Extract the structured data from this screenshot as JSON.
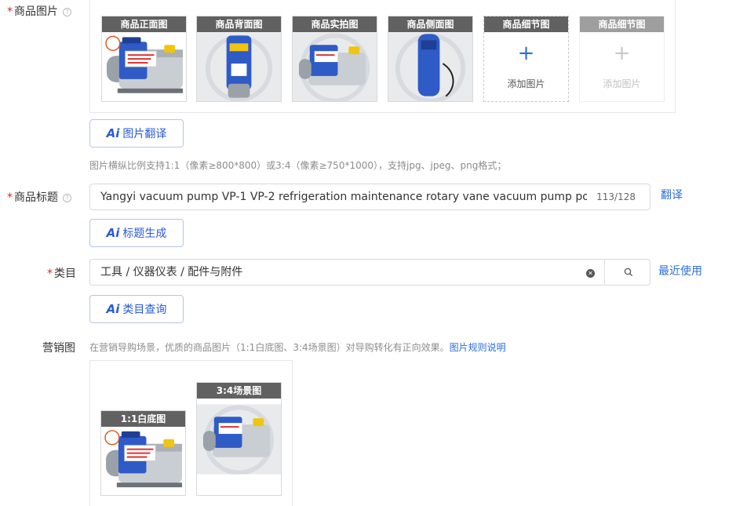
{
  "product_images": {
    "label": "商品图片",
    "slots": [
      {
        "tag": "商品正面图",
        "kind": "photo"
      },
      {
        "tag": "商品背面图",
        "kind": "photo"
      },
      {
        "tag": "商品实拍图",
        "kind": "photo"
      },
      {
        "tag": "商品侧面图",
        "kind": "photo"
      },
      {
        "tag": "商品细节图",
        "kind": "add",
        "add_text": "添加图片"
      },
      {
        "tag": "商品细节图",
        "kind": "add-disabled",
        "add_text": "添加图片"
      }
    ],
    "translate_button": "图片翻译",
    "hint": "图片横纵比例支持1:1（像素≥800*800）或3:4（像素≥750*1000），支持jpg、jpeg、png格式；"
  },
  "product_title": {
    "label": "商品标题",
    "value": "Yangyi vacuum pump VP-1 VP-2 refrigeration maintenance rotary vane vacuum pump portable",
    "count": "113/128",
    "translate_link": "翻译",
    "generate_button": "标题生成"
  },
  "category": {
    "label": "类目",
    "value": "工具 / 仪器仪表 / 配件与附件",
    "recent_link": "最近使用",
    "query_button": "类目查询"
  },
  "marketing": {
    "label": "营销图",
    "hint": "在营销导购场景，优质的商品图片（1:1白底图、3:4场景图）对导购转化有正向效果。",
    "rules_link": "图片规则说明",
    "slots": [
      {
        "tag": "1:1白底图"
      },
      {
        "tag": "3:4场景图"
      }
    ]
  },
  "ai_badge": "Ai",
  "colors": {
    "accent": "#2a6fdb",
    "required": "#e02020",
    "tag_bg": "#616161",
    "pump_blue": "#2a55c4"
  }
}
